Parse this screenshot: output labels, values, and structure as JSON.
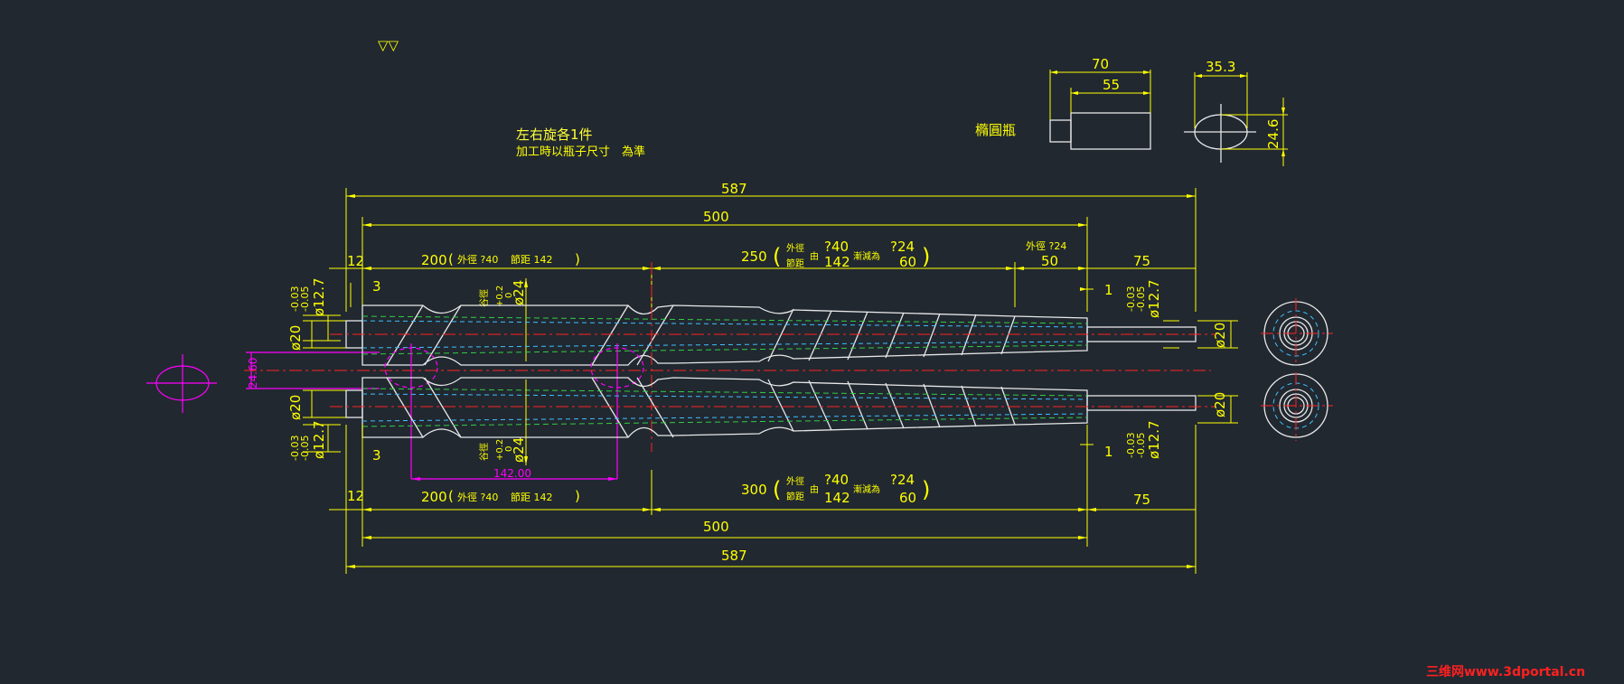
{
  "drawing": {
    "surface_symbol": "▽▽",
    "note_line1": "左右旋各1件",
    "note_line2": "加工時以瓶子尺寸　為準",
    "bottle_label": "橢圓瓶"
  },
  "bottle_dims": {
    "d70": "70",
    "d55": "55",
    "d35_3": "35.3",
    "d24_6": "24.6"
  },
  "top_screw": {
    "overall": "587",
    "body": "500",
    "left_end": "12",
    "seg1_len": "200",
    "seg1_label_a": "外徑 ?40",
    "seg1_label_b": "節距 142",
    "seg1_paren_close": ")",
    "seg2_len": "250",
    "seg2_od_word": "外徑",
    "seg2_pitch_word": "節距",
    "seg2_from": "由",
    "seg2_od_from": "?40",
    "seg2_pitch_from": "142",
    "seg2_reduce": "漸減為",
    "seg2_od_to": "?24",
    "seg2_pitch_to": "60",
    "seg3_label": "外徑 ?24",
    "seg3_len": "50",
    "right_end": "75",
    "d3": "3",
    "d1": "1",
    "valley_note": "谷徑",
    "tol_plus": "+0.2",
    "tol_zero": "0",
    "valley_dia": "ø24",
    "shaft_tol_a": "-0.03",
    "shaft_tol_b": "-0.05",
    "shaft_dia": "ø12.7",
    "dia20": "ø20"
  },
  "bottom_screw": {
    "overall": "587",
    "body": "500",
    "left_end": "12",
    "seg1_len": "200",
    "seg1_label_a": "外徑 ?40",
    "seg1_label_b": "節距 142",
    "seg2_len": "300",
    "seg2_od_word": "外徑",
    "seg2_pitch_word": "節距",
    "seg2_from": "由",
    "seg2_od_from": "?40",
    "seg2_pitch_from": "142",
    "seg2_reduce": "漸減為",
    "seg2_od_to": "?24",
    "seg2_pitch_to": "60",
    "right_end": "75",
    "d3": "3",
    "d1": "1",
    "valley_note": "谷徑",
    "tol_plus": "+0.2",
    "tol_zero": "0",
    "valley_dia": "ø24",
    "shaft_tol_a": "-0.03",
    "shaft_tol_b": "-0.05",
    "shaft_dia": "ø12.7",
    "dia20": "ø20",
    "pitch_mark": "142.00"
  },
  "left_marker": {
    "dim": "24.60"
  },
  "watermark": "三维网www.3dportal.cn",
  "colors": {
    "background": "#212830",
    "dimension": "#ffff00",
    "outline": "#e8e8e8",
    "centerline": "#ff2222",
    "hidden": "#33cc44",
    "highlight": "#ff00ff"
  }
}
